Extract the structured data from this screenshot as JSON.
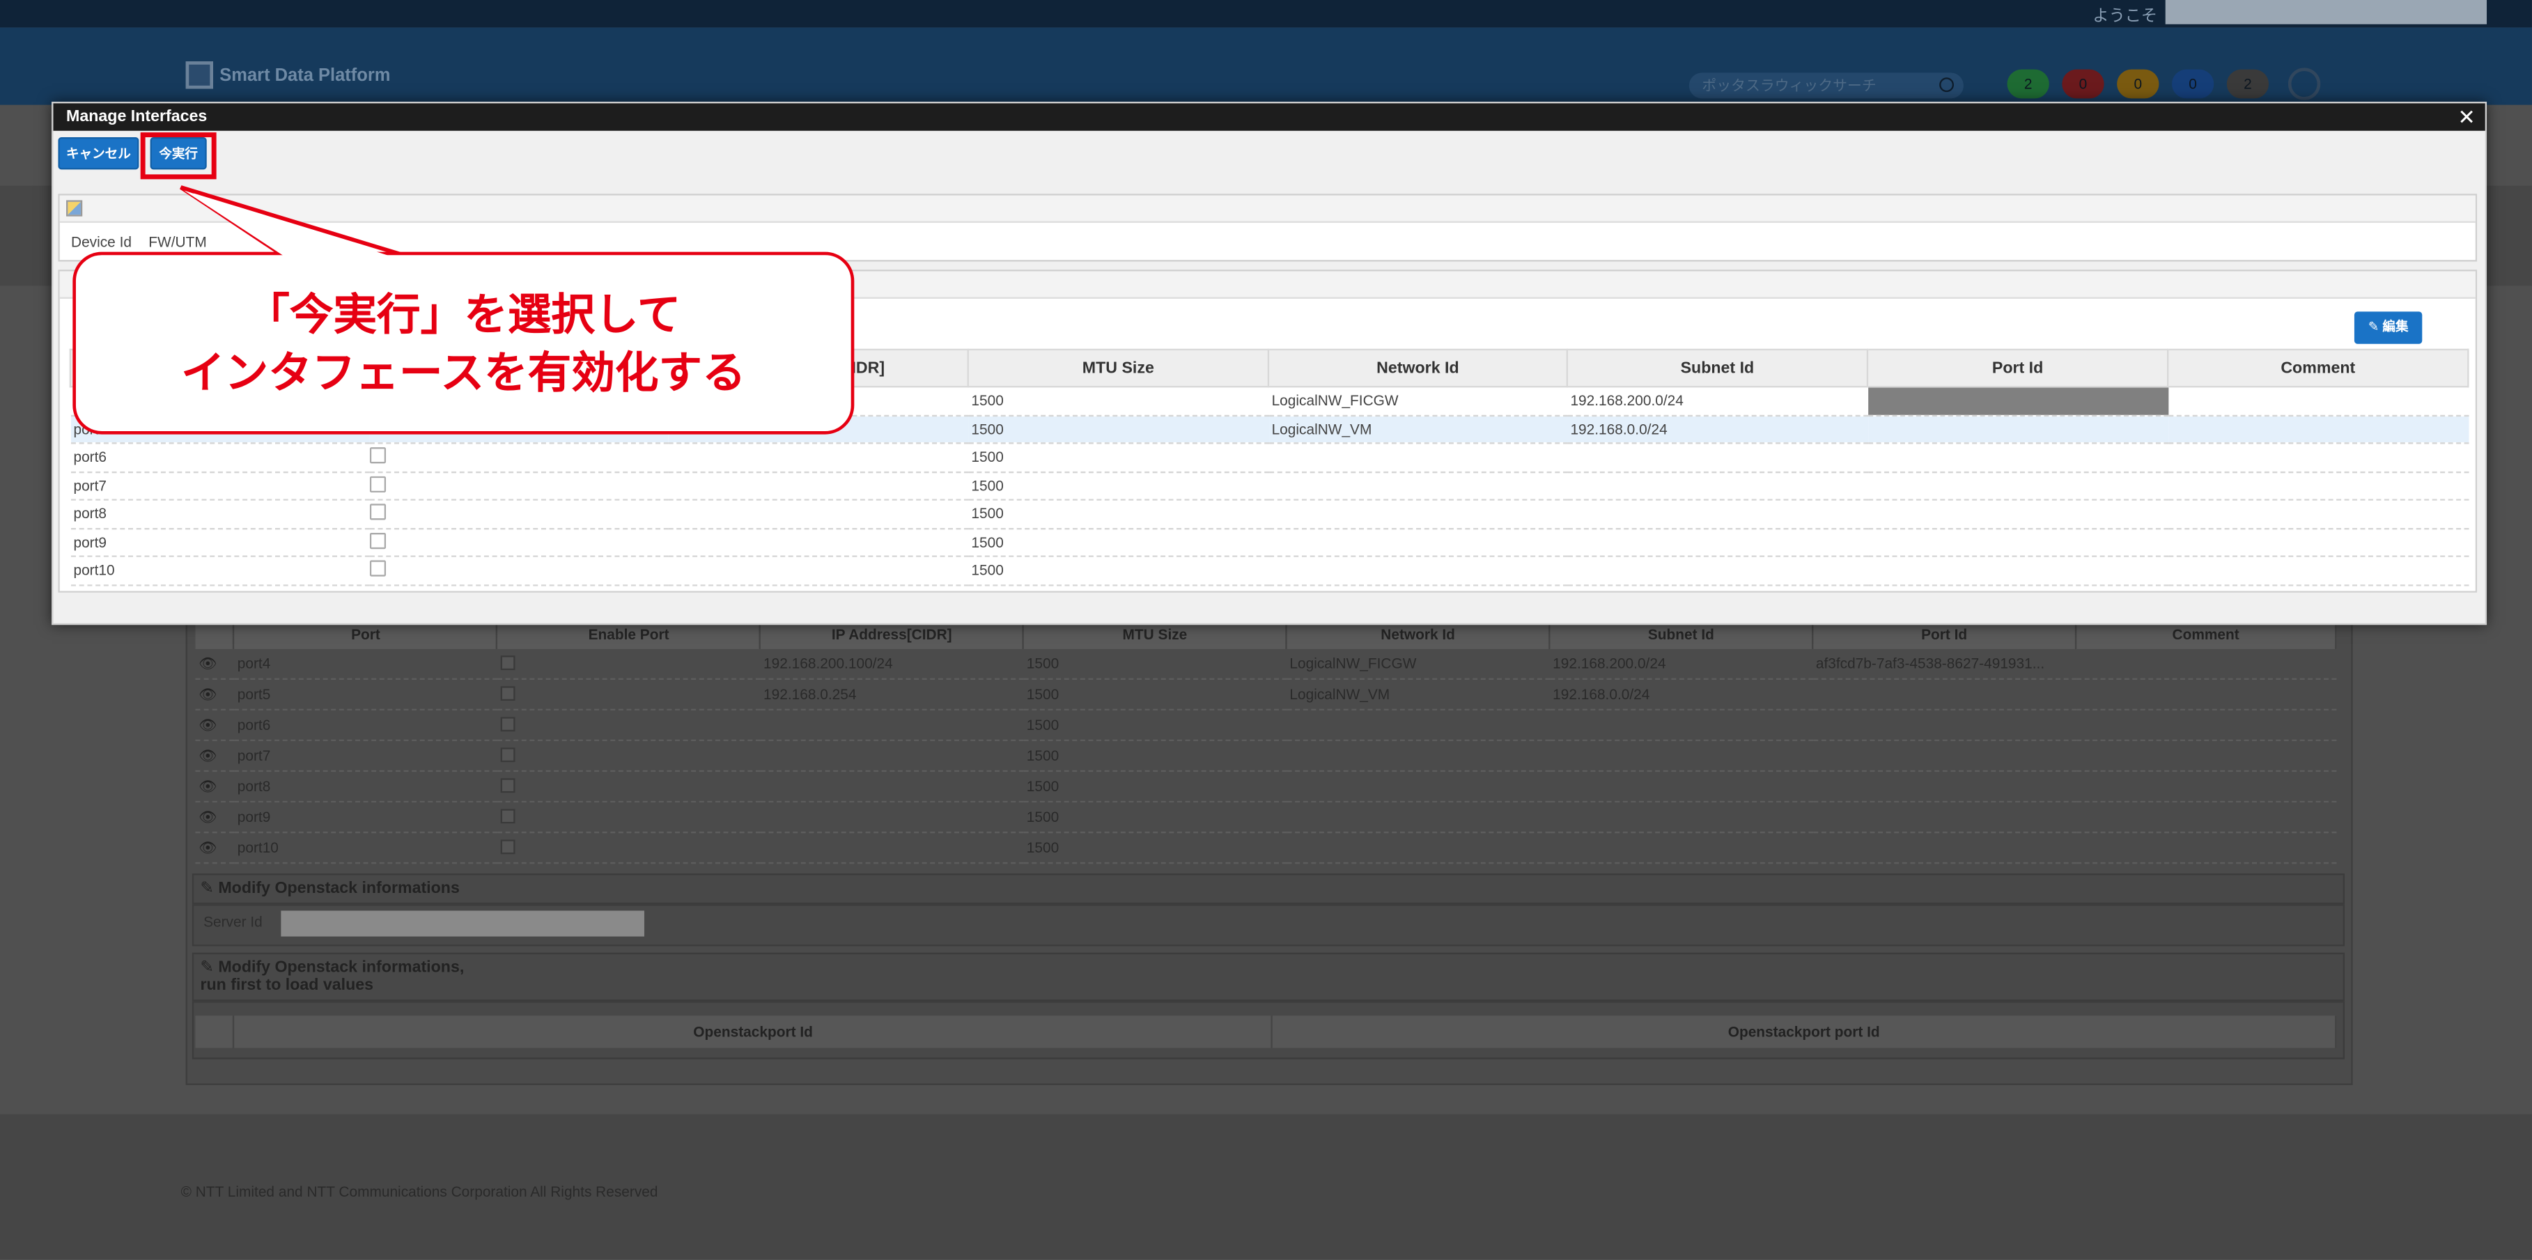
{
  "topbar": {
    "welcome": "ようこそ"
  },
  "header": {
    "app_name": "Smart Data Platform",
    "search_placeholder": "ポッタスラウィックサーチ",
    "badges": [
      {
        "value": "2",
        "color": "#1e6b33"
      },
      {
        "value": "0",
        "color": "#6b1a1d"
      },
      {
        "value": "0",
        "color": "#7a5a10"
      },
      {
        "value": "0",
        "color": "#153e78"
      },
      {
        "value": "2",
        "color": "#3a3a3a"
      }
    ]
  },
  "background": {
    "table": {
      "headers": [
        "Port",
        "Enable Port",
        "IP Address[CIDR]",
        "MTU Size",
        "Network Id",
        "Subnet Id",
        "Port Id",
        "Comment"
      ],
      "rows": [
        [
          "port4",
          "checked",
          "192.168.200.100/24",
          "1500",
          "LogicalNW_FICGW",
          "192.168.200.0/24",
          "af3fcd7b-7af3-4538-8627-491931...",
          ""
        ],
        [
          "port5",
          "checked",
          "192.168.0.254",
          "1500",
          "LogicalNW_VM",
          "192.168.0.0/24",
          "",
          ""
        ],
        [
          "port6",
          "",
          "",
          "1500",
          "",
          "",
          "",
          ""
        ],
        [
          "port7",
          "",
          "",
          "1500",
          "",
          "",
          "",
          ""
        ],
        [
          "port8",
          "",
          "",
          "1500",
          "",
          "",
          "",
          ""
        ],
        [
          "port9",
          "",
          "",
          "1500",
          "",
          "",
          "",
          ""
        ],
        [
          "port10",
          "",
          "",
          "1500",
          "",
          "",
          "",
          ""
        ]
      ]
    },
    "openstack_section": {
      "title": "Modify Openstack informations",
      "server_label": "Server Id"
    },
    "openstack_run_section": {
      "title_line1": "Modify Openstack informations,",
      "title_line2": "run first to load values",
      "headers": [
        "Openstackport Id",
        "Openstackport port Id"
      ]
    },
    "footer": "© NTT Limited and NTT Communications Corporation All Rights Reserved"
  },
  "modal": {
    "title": "Manage Interfaces",
    "cancel_label": "キャンセル",
    "execute_label": "今実行",
    "device_label": "Device Id",
    "device_value": "FW/UTM",
    "edit_label": "編集",
    "table": {
      "headers": [
        "Port",
        "Enable Port",
        "IP Address[CIDR]",
        "MTU Size",
        "Network Id",
        "Subnet Id",
        "Port Id",
        "Comment"
      ],
      "rows": [
        {
          "port": "port4",
          "mtu": "1500",
          "network": "LogicalNW_FICGW",
          "subnet": "192.168.200.0/24"
        },
        {
          "port": "port5",
          "mtu": "1500",
          "network": "LogicalNW_VM",
          "subnet": "192.168.0.0/24"
        },
        {
          "port": "port6",
          "mtu": "1500",
          "network": "",
          "subnet": ""
        },
        {
          "port": "port7",
          "mtu": "1500",
          "network": "",
          "subnet": ""
        },
        {
          "port": "port8",
          "mtu": "1500",
          "network": "",
          "subnet": ""
        },
        {
          "port": "port9",
          "mtu": "1500",
          "network": "",
          "subnet": ""
        },
        {
          "port": "port10",
          "mtu": "1500",
          "network": "",
          "subnet": ""
        }
      ]
    }
  },
  "callout": {
    "line1": "「今実行」を選択して",
    "line2": "インタフェースを有効化する"
  },
  "colors": {
    "accent": "#1a73c6",
    "highlight": "#e60012"
  }
}
